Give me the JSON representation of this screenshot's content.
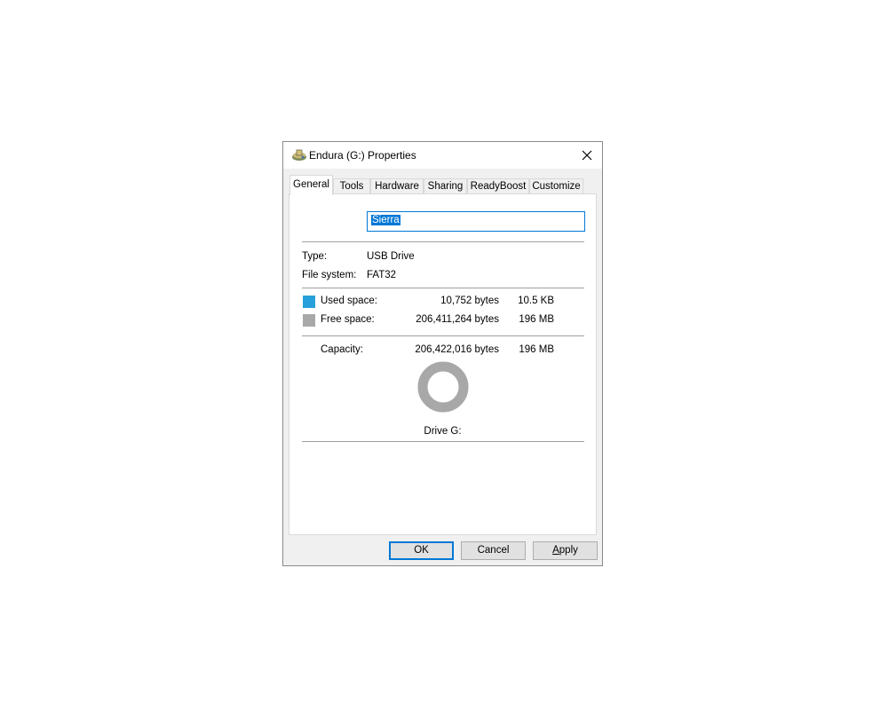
{
  "window": {
    "title": "Endura (G:) Properties"
  },
  "tabs": [
    "General",
    "Tools",
    "Hardware",
    "Sharing",
    "ReadyBoost",
    "Customize"
  ],
  "active_tab": "General",
  "general": {
    "name_value": "Sierra",
    "type_label": "Type:",
    "type_value": "USB Drive",
    "fs_label": "File system:",
    "fs_value": "FAT32",
    "used_label": "Used space:",
    "used_bytes": "10,752 bytes",
    "used_size": "10.5 KB",
    "free_label": "Free space:",
    "free_bytes": "206,411,264 bytes",
    "free_size": "196 MB",
    "capacity_label": "Capacity:",
    "capacity_bytes": "206,422,016 bytes",
    "capacity_size": "196 MB",
    "drive_label": "Drive G:",
    "used_fraction": 5.21e-05
  },
  "colors": {
    "used": "#26a0da",
    "free": "#a8a8a8",
    "accent": "#0078d7"
  },
  "buttons": {
    "ok": "OK",
    "cancel": "Cancel",
    "apply_first": "A",
    "apply_rest": "pply"
  }
}
